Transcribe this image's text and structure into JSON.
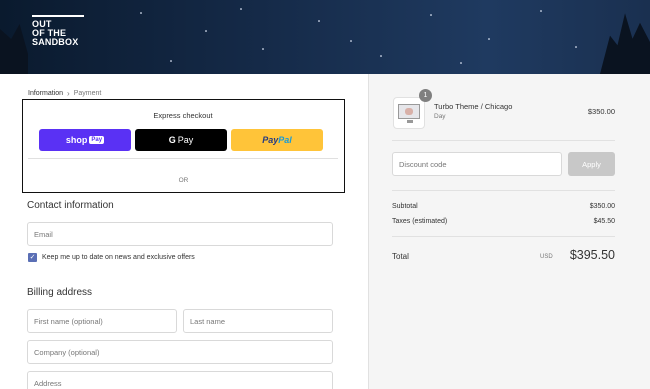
{
  "brand": {
    "logo_lines": [
      "OUT",
      "OF THE",
      "SANDBOX"
    ]
  },
  "breadcrumb": {
    "step1": "Information",
    "step2": "Payment"
  },
  "express_checkout": {
    "title": "Express checkout",
    "shop_pay": {
      "label": "shop",
      "tag": "Pay"
    },
    "google_pay": {
      "g": "G",
      "label": "Pay"
    },
    "paypal": {
      "pay": "Pay",
      "pal": "Pal"
    },
    "or": "OR"
  },
  "contact": {
    "title": "Contact information",
    "email_placeholder": "Email",
    "newsletter_label": "Keep me up to date on news and exclusive offers",
    "newsletter_checked": true
  },
  "billing": {
    "title": "Billing address",
    "first_name_placeholder": "First name (optional)",
    "last_name_placeholder": "Last name",
    "company_placeholder": "Company (optional)",
    "address_placeholder": "Address"
  },
  "order": {
    "quantity": "1",
    "product_name": "Turbo Theme / Chicago",
    "product_variant": "Day",
    "product_price": "$350.00",
    "discount_placeholder": "Discount code",
    "apply_label": "Apply",
    "subtotal_label": "Subtotal",
    "subtotal_value": "$350.00",
    "taxes_label": "Taxes (estimated)",
    "taxes_value": "$45.50",
    "total_label": "Total",
    "currency": "USD",
    "total_value": "$395.50"
  },
  "colors": {
    "shop_pay": "#5a31f4",
    "google_pay": "#000000",
    "paypal": "#ffc439",
    "checkbox": "#5a6fb5",
    "apply_disabled": "#c8c8c8"
  }
}
